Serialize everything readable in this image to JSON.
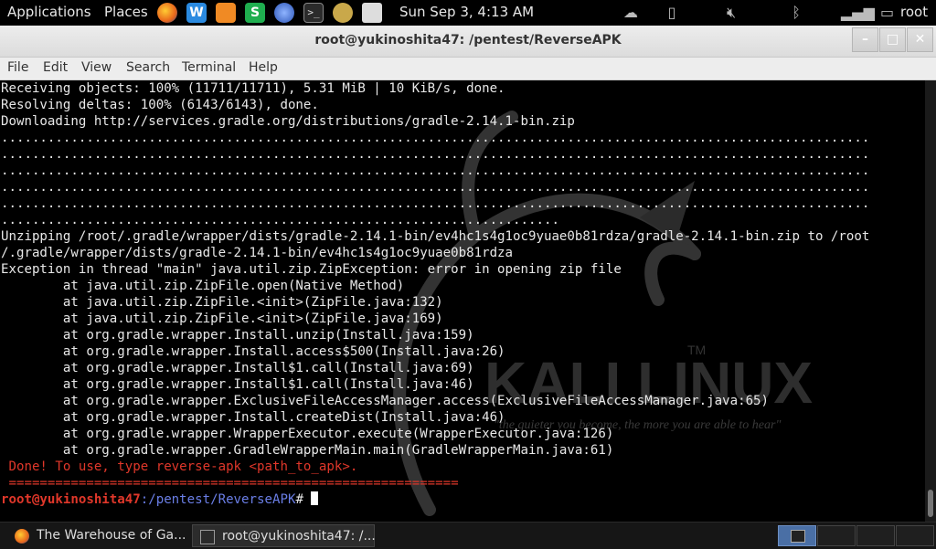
{
  "top_panel": {
    "applications_label": "Applications",
    "places_label": "Places",
    "clock": "Sun Sep  3,  4:13 AM",
    "user": "root"
  },
  "window": {
    "title": "root@yukinoshita47: /pentest/ReverseAPK"
  },
  "menubar": {
    "items": [
      "File",
      "Edit",
      "View",
      "Search",
      "Terminal",
      "Help"
    ]
  },
  "terminal": {
    "lines": [
      "Receiving objects: 100% (11711/11711), 5.31 MiB | 10 KiB/s, done.",
      "Resolving deltas: 100% (6143/6143), done.",
      "Downloading http://services.gradle.org/distributions/gradle-2.14.1-bin.zip",
      "................................................................................................................",
      "................................................................................................................",
      "................................................................................................................",
      "................................................................................................................",
      "................................................................................................................",
      "........................................................................",
      "Unzipping /root/.gradle/wrapper/dists/gradle-2.14.1-bin/ev4hc1s4g1oc9yuae0b81rdza/gradle-2.14.1-bin.zip to /root",
      "/.gradle/wrapper/dists/gradle-2.14.1-bin/ev4hc1s4g1oc9yuae0b81rdza",
      "Exception in thread \"main\" java.util.zip.ZipException: error in opening zip file",
      "        at java.util.zip.ZipFile.open(Native Method)",
      "        at java.util.zip.ZipFile.<init>(ZipFile.java:132)",
      "        at java.util.zip.ZipFile.<init>(ZipFile.java:169)",
      "        at org.gradle.wrapper.Install.unzip(Install.java:159)",
      "        at org.gradle.wrapper.Install.access$500(Install.java:26)",
      "        at org.gradle.wrapper.Install$1.call(Install.java:69)",
      "        at org.gradle.wrapper.Install$1.call(Install.java:46)",
      "        at org.gradle.wrapper.ExclusiveFileAccessManager.access(ExclusiveFileAccessManager.java:65)",
      "        at org.gradle.wrapper.Install.createDist(Install.java:46)",
      "        at org.gradle.wrapper.WrapperExecutor.execute(WrapperExecutor.java:126)",
      "        at org.gradle.wrapper.GradleWrapperMain.main(GradleWrapperMain.java:61)"
    ],
    "done_message": " Done! To use, type reverse-apk <path_to_apk>.",
    "separator": " ==========================================================",
    "prompt_user": "root@yukinoshita47",
    "prompt_path": ":/pentest/ReverseAPK",
    "prompt_symbol": "# ",
    "watermark_logo": "KALI LINUX",
    "watermark_tm": "TM",
    "watermark_slogan": "\"the quieter you become, the more you are able to hear\""
  },
  "taskbar": {
    "tasks": [
      {
        "label": "The Warehouse of Ga...",
        "icon": "firefox-icon"
      },
      {
        "label": "root@yukinoshita47: /...",
        "icon": "terminal-icon"
      }
    ]
  },
  "colors": {
    "error_red": "#e0372a",
    "prompt_blue": "#6a7ee6",
    "terminal_bg": "#000000",
    "terminal_fg": "#e8e8e8"
  }
}
